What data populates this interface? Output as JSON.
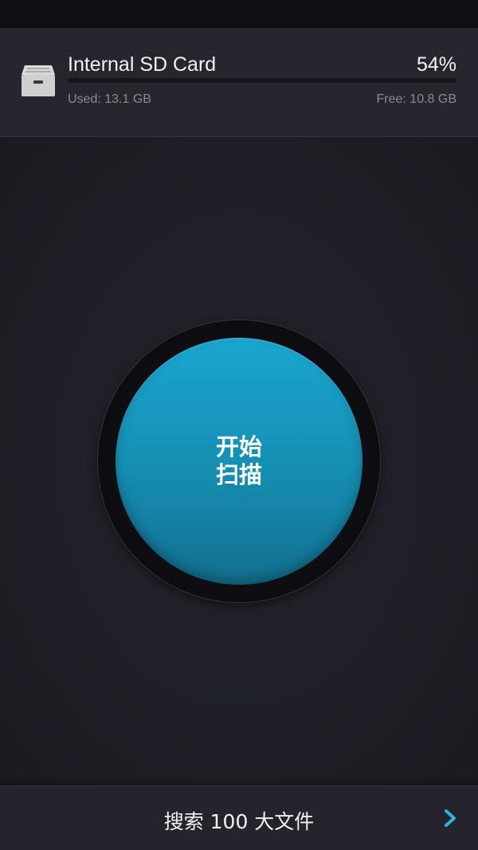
{
  "storage": {
    "title": "Internal SD Card",
    "percent_label": "54%",
    "used_fraction": 0.54,
    "used_label": "Used: 13.1 GB",
    "free_label": "Free: 10.8 GB",
    "icon": "drive-icon"
  },
  "scan": {
    "line1": "开始",
    "line2": "扫描",
    "button_color": "#1aa6d0"
  },
  "bottom": {
    "label": "搜索 100 大文件",
    "icon": "chevron-right-icon",
    "icon_color": "#2ab3e0"
  }
}
